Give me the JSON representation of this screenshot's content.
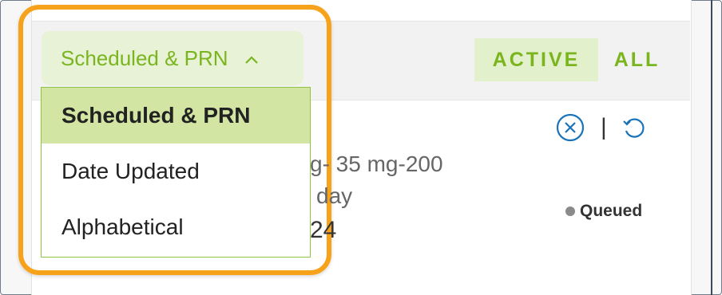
{
  "sort": {
    "selected_label": "Scheduled & PRN",
    "options": [
      "Scheduled & PRN",
      "Date Updated",
      "Alphabetical"
    ]
  },
  "filter_tabs": {
    "active": "ACTIVE",
    "all": "ALL"
  },
  "order": {
    "detail_line1": "g- 35 mg-200",
    "detail_line2": "day",
    "detail_line3": "24",
    "status": "Queued"
  },
  "colors": {
    "accent_green": "#7ab51d",
    "highlight_orange": "#f7a21b",
    "icon_blue": "#1a73b8"
  },
  "icons": [
    "chevron-up-icon",
    "cancel-circle-icon",
    "refresh-icon"
  ]
}
